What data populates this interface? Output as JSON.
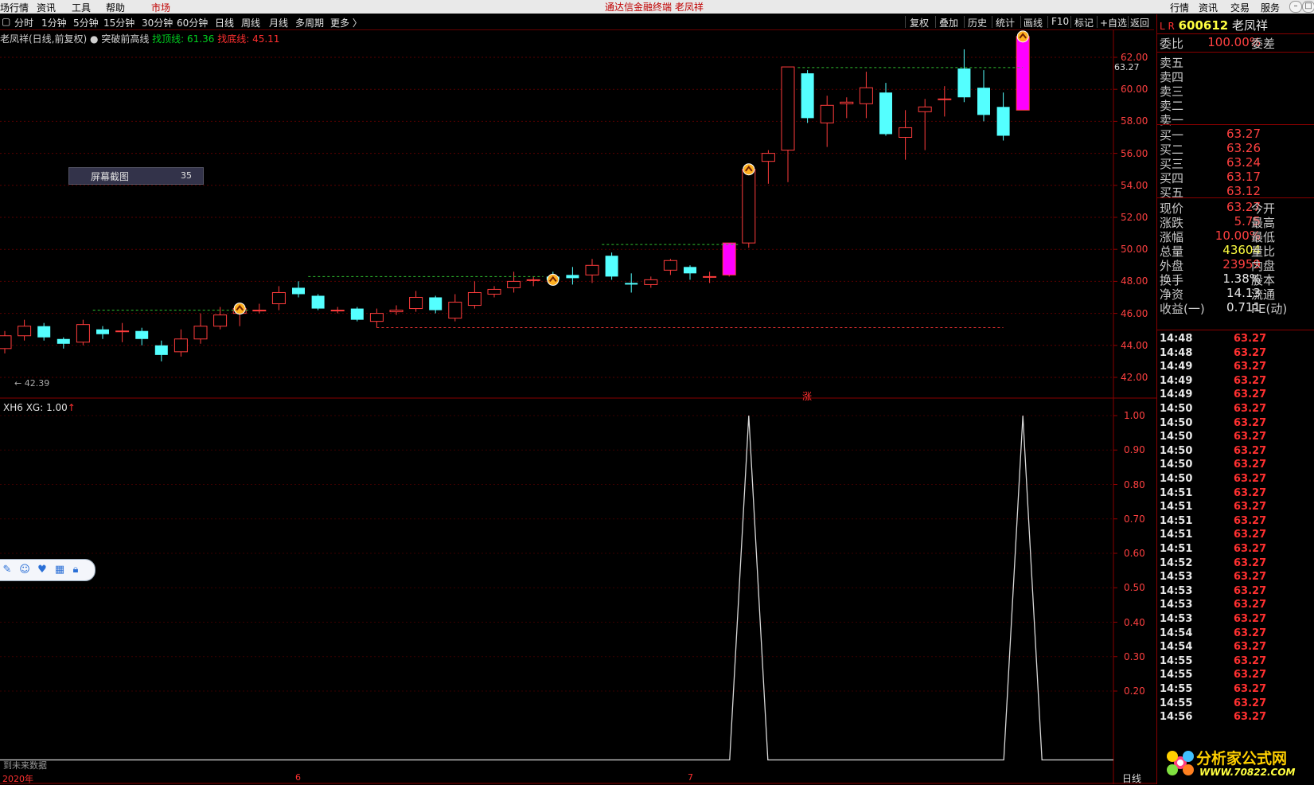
{
  "menu": {
    "items": [
      "场行情",
      "资讯",
      "工具",
      "帮助",
      "市场"
    ],
    "title": "通达信金融终端  老凤祥",
    "right_items": [
      "行情",
      "资讯",
      "交易",
      "服务"
    ]
  },
  "periods": [
    "分时",
    "1分钟",
    "5分钟",
    "15分钟",
    "30分钟",
    "60分钟",
    "日线",
    "周线",
    "月线",
    "多周期",
    "更多 〉"
  ],
  "toolbar_right": [
    "复权",
    "叠加",
    "历史",
    "统计",
    "画线",
    "F10",
    "标记",
    "+自选",
    "返回"
  ],
  "info": {
    "stock_title": "老凤祥(日线,前复权)",
    "indicator_name": "突破前高线",
    "top_line_label": "找顶线: 61.36",
    "bottom_line_label": "找底线: 45.11"
  },
  "popup": {
    "label": "屏幕截图",
    "value": "35"
  },
  "main_chart": {
    "price_axis": [
      "62.00",
      "60.00",
      "58.00",
      "56.00",
      "54.00",
      "52.00",
      "50.00",
      "48.00",
      "46.00",
      "44.00",
      "42.00"
    ],
    "last_price_label": "63.27",
    "low_label": "← 42.39",
    "marker_text": "涨",
    "bottom_left_note": "到未来数据"
  },
  "sub_chart": {
    "title": "XH6  XG: 1.00",
    "axis": [
      "1.00",
      "0.90",
      "0.80",
      "0.70",
      "0.60",
      "0.50",
      "0.40",
      "0.30",
      "0.20"
    ]
  },
  "date_axis": [
    "2020年",
    "6",
    "7"
  ],
  "bottom_right_label": "日线",
  "chart_data": {
    "type": "candlestick",
    "ylim": [
      42,
      63.5
    ],
    "candles": [
      [
        43.8,
        44.6,
        43.5,
        44.9
      ],
      [
        44.6,
        45.2,
        44.3,
        45.6
      ],
      [
        45.2,
        44.5,
        44.3,
        45.4
      ],
      [
        44.4,
        44.1,
        43.8,
        44.5
      ],
      [
        44.2,
        45.3,
        44.0,
        45.6
      ],
      [
        45.0,
        44.7,
        44.4,
        45.2
      ],
      [
        44.9,
        44.9,
        44.2,
        45.4
      ],
      [
        44.9,
        44.4,
        44.0,
        45.1
      ],
      [
        44.0,
        43.4,
        43.0,
        44.3
      ],
      [
        43.6,
        44.4,
        43.3,
        45.0
      ],
      [
        44.4,
        45.2,
        44.1,
        46.0
      ],
      [
        45.2,
        45.9,
        45.0,
        46.4
      ],
      [
        46.0,
        46.3,
        45.2,
        46.6
      ],
      [
        46.2,
        46.2,
        46.0,
        46.6
      ],
      [
        46.6,
        47.3,
        46.2,
        47.7
      ],
      [
        47.6,
        47.2,
        47.0,
        48.0
      ],
      [
        47.1,
        46.3,
        46.2,
        47.2
      ],
      [
        46.2,
        46.2,
        46.0,
        46.4
      ],
      [
        46.3,
        45.6,
        45.5,
        46.4
      ],
      [
        45.5,
        46.0,
        45.1,
        46.3
      ],
      [
        46.1,
        46.2,
        45.9,
        46.5
      ],
      [
        46.3,
        47.0,
        46.1,
        47.4
      ],
      [
        47.0,
        46.2,
        46.0,
        47.1
      ],
      [
        45.7,
        46.7,
        45.5,
        47.2
      ],
      [
        46.5,
        47.3,
        46.3,
        48.0
      ],
      [
        47.2,
        47.5,
        47.0,
        47.7
      ],
      [
        47.6,
        48.0,
        47.3,
        48.6
      ],
      [
        48.1,
        48.1,
        47.7,
        48.3
      ],
      [
        48.3,
        48.1,
        47.8,
        48.6
      ],
      [
        48.4,
        48.2,
        47.8,
        48.9
      ],
      [
        48.4,
        49.0,
        47.9,
        49.4
      ],
      [
        49.6,
        48.3,
        48.1,
        49.8
      ],
      [
        47.9,
        47.8,
        47.3,
        48.5
      ],
      [
        47.8,
        48.1,
        47.6,
        48.3
      ],
      [
        48.7,
        49.3,
        48.4,
        49.4
      ],
      [
        48.9,
        48.5,
        48.1,
        49.0
      ],
      [
        48.3,
        48.3,
        47.9,
        48.6
      ],
      [
        48.4,
        50.4,
        48.3,
        50.4
      ],
      [
        50.4,
        55.0,
        50.1,
        55.0
      ],
      [
        55.5,
        56.0,
        54.1,
        56.2
      ],
      [
        56.2,
        61.4,
        54.2,
        61.4
      ],
      [
        61.0,
        58.2,
        57.9,
        61.2
      ],
      [
        57.9,
        59.0,
        56.4,
        59.6
      ],
      [
        59.1,
        59.2,
        58.2,
        59.5
      ],
      [
        59.1,
        60.1,
        58.2,
        61.1
      ],
      [
        59.8,
        57.2,
        57.1,
        60.4
      ],
      [
        57.0,
        57.6,
        55.6,
        58.7
      ],
      [
        58.6,
        58.9,
        56.2,
        59.4
      ],
      [
        59.4,
        59.4,
        58.3,
        60.2
      ],
      [
        61.3,
        59.5,
        59.2,
        62.5
      ],
      [
        60.1,
        58.4,
        58.0,
        61.2
      ],
      [
        58.9,
        57.1,
        56.8,
        59.8
      ],
      [
        58.7,
        63.3,
        58.7,
        63.3
      ]
    ],
    "signal_indices": [
      37,
      52
    ],
    "markers": [
      12,
      28,
      38,
      52
    ],
    "top_line": 61.36,
    "bottom_line": 45.11,
    "xg_series_peaks": [
      38,
      52
    ]
  },
  "order_book": {
    "ratio_label": "委比",
    "ratio_value": "100.00%",
    "diff_label": "委差",
    "sells": [
      "卖五",
      "卖四",
      "卖三",
      "卖二",
      "卖一"
    ],
    "buys": [
      {
        "label": "买一",
        "price": "63.27"
      },
      {
        "label": "买二",
        "price": "63.26"
      },
      {
        "label": "买三",
        "price": "63.24"
      },
      {
        "label": "买四",
        "price": "63.17"
      },
      {
        "label": "买五",
        "price": "63.12"
      }
    ],
    "stats": [
      {
        "l": "现价",
        "v": "63.27",
        "l2": "今开",
        "color": "#ff4040"
      },
      {
        "l": "涨跌",
        "v": "5.75",
        "l2": "最高",
        "color": "#ff4040"
      },
      {
        "l": "涨幅",
        "v": "10.00%",
        "l2": "最低",
        "color": "#ff4040"
      },
      {
        "l": "总量",
        "v": "43604",
        "l2": "量比",
        "color": "#ffff40"
      },
      {
        "l": "外盘",
        "v": "23959",
        "l2": "内盘",
        "color": "#ff4040"
      },
      {
        "l": "换手",
        "v": "1.38%",
        "l2": "股本",
        "color": "#e8e8e8"
      },
      {
        "l": "净资",
        "v": "14.13",
        "l2": "流通",
        "color": "#e8e8e8"
      },
      {
        "l": "收益(一)",
        "v": "0.711",
        "l2": "PE(动)",
        "color": "#e8e8e8"
      }
    ]
  },
  "header": {
    "code": "600612",
    "name": "老凤祥",
    "flags": "L R"
  },
  "ticks": [
    [
      "14:48",
      "63.27"
    ],
    [
      "14:48",
      "63.27"
    ],
    [
      "14:49",
      "63.27"
    ],
    [
      "14:49",
      "63.27"
    ],
    [
      "14:49",
      "63.27"
    ],
    [
      "14:50",
      "63.27"
    ],
    [
      "14:50",
      "63.27"
    ],
    [
      "14:50",
      "63.27"
    ],
    [
      "14:50",
      "63.27"
    ],
    [
      "14:50",
      "63.27"
    ],
    [
      "14:50",
      "63.27"
    ],
    [
      "14:51",
      "63.27"
    ],
    [
      "14:51",
      "63.27"
    ],
    [
      "14:51",
      "63.27"
    ],
    [
      "14:51",
      "63.27"
    ],
    [
      "14:51",
      "63.27"
    ],
    [
      "14:52",
      "63.27"
    ],
    [
      "14:53",
      "63.27"
    ],
    [
      "14:53",
      "63.27"
    ],
    [
      "14:53",
      "63.27"
    ],
    [
      "14:53",
      "63.27"
    ],
    [
      "14:54",
      "63.27"
    ],
    [
      "14:54",
      "63.27"
    ],
    [
      "14:55",
      "63.27"
    ],
    [
      "14:55",
      "63.27"
    ],
    [
      "14:55",
      "63.27"
    ],
    [
      "14:55",
      "63.27"
    ],
    [
      "14:56",
      "63.27"
    ]
  ],
  "logo": {
    "text": "分析家公式网",
    "url_text": "WWW.70822.COM"
  }
}
